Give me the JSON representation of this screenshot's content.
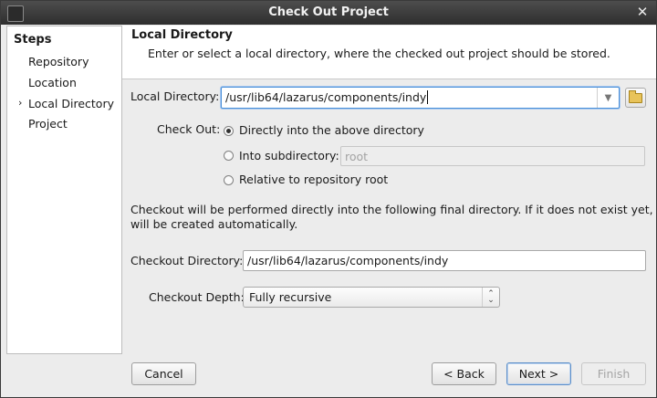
{
  "window": {
    "title": "Check Out Project"
  },
  "steps": {
    "title": "Steps",
    "current_marker": "›",
    "items": [
      {
        "label": "Repository"
      },
      {
        "label": "Location"
      },
      {
        "label": "Local Directory"
      },
      {
        "label": "Project"
      }
    ]
  },
  "header": {
    "title": "Local Directory",
    "description": "Enter or select a local directory, where the checked out project should be stored."
  },
  "form": {
    "local_directory_label": "Local Directory:",
    "local_directory_value": "/usr/lib64/lazarus/components/indy",
    "checkout_label": "Check Out:",
    "options": [
      {
        "label": "Directly into the above directory",
        "selected": true
      },
      {
        "label": "Into subdirectory:",
        "selected": false
      },
      {
        "label": "Relative to repository root",
        "selected": false
      }
    ],
    "subdirectory_value": "root",
    "info_text_1": "Checkout will be performed directly into the following final directory. If it does not exist yet, it",
    "info_text_2": "will be created automatically.",
    "checkout_directory_label": "Checkout Directory:",
    "checkout_directory_value": "/usr/lib64/lazarus/components/indy",
    "checkout_depth_label": "Checkout Depth:",
    "checkout_depth_value": "Fully recursive"
  },
  "buttons": {
    "cancel": "Cancel",
    "back": "< Back",
    "next": "Next >",
    "finish": "Finish"
  },
  "icons": {
    "close": "close-icon",
    "folder": "folder-icon",
    "app": "app-icon"
  }
}
